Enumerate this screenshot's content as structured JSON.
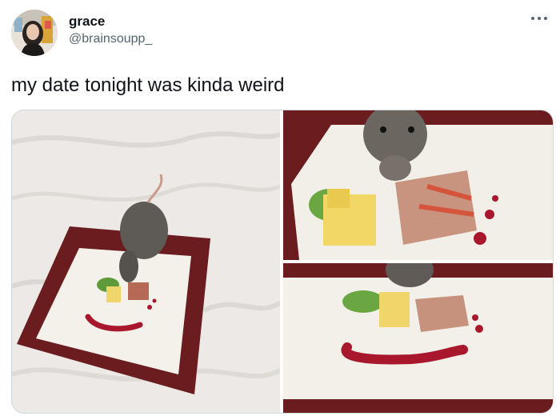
{
  "tweet": {
    "author": {
      "display_name": "grace",
      "handle": "@brainsoupp_"
    },
    "text": "my date tonight was kinda weird",
    "more_icon": "more-horizontal-icon",
    "media": [
      {
        "alt": "rat standing on a small plate of food on a bed"
      },
      {
        "alt": "close-up of rat eating from the plate"
      },
      {
        "alt": "rat behind the plate with cheese, lettuce and ham"
      }
    ]
  }
}
